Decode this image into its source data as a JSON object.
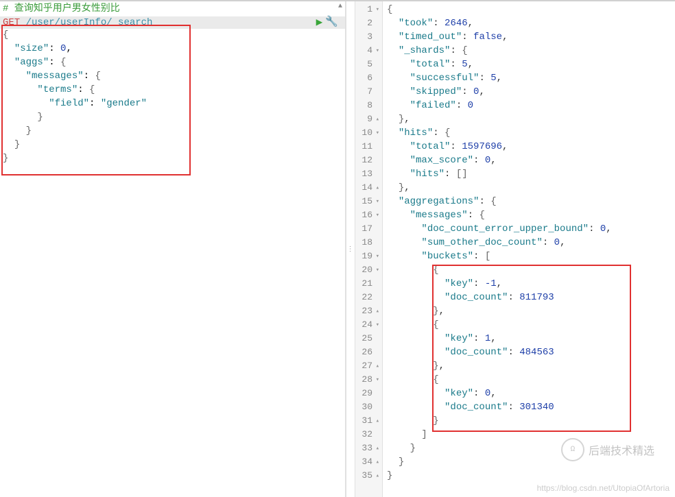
{
  "left": {
    "comment": "# 查询知乎用户男女性别比",
    "method": "GET",
    "path": " /user/userInfo/_search",
    "lines": [
      "{",
      "  \"size\": 0,",
      "  \"aggs\": {",
      "    \"messages\": {",
      "      \"terms\": {",
      "        \"field\": \"gender\"",
      "      }",
      "    }",
      "  }",
      "}"
    ]
  },
  "right": {
    "lines": [
      {
        "n": "1",
        "fold": "▾",
        "t": "{"
      },
      {
        "n": "2",
        "t": "  \"took\": 2646,"
      },
      {
        "n": "3",
        "t": "  \"timed_out\": false,"
      },
      {
        "n": "4",
        "fold": "▾",
        "t": "  \"_shards\": {"
      },
      {
        "n": "5",
        "t": "    \"total\": 5,"
      },
      {
        "n": "6",
        "t": "    \"successful\": 5,"
      },
      {
        "n": "7",
        "t": "    \"skipped\": 0,"
      },
      {
        "n": "8",
        "t": "    \"failed\": 0"
      },
      {
        "n": "9",
        "fold": "▴",
        "t": "  },"
      },
      {
        "n": "10",
        "fold": "▾",
        "t": "  \"hits\": {"
      },
      {
        "n": "11",
        "t": "    \"total\": 1597696,"
      },
      {
        "n": "12",
        "t": "    \"max_score\": 0,"
      },
      {
        "n": "13",
        "t": "    \"hits\": []"
      },
      {
        "n": "14",
        "fold": "▴",
        "t": "  },"
      },
      {
        "n": "15",
        "fold": "▾",
        "t": "  \"aggregations\": {"
      },
      {
        "n": "16",
        "fold": "▾",
        "t": "    \"messages\": {"
      },
      {
        "n": "17",
        "t": "      \"doc_count_error_upper_bound\": 0,"
      },
      {
        "n": "18",
        "t": "      \"sum_other_doc_count\": 0,"
      },
      {
        "n": "19",
        "fold": "▾",
        "t": "      \"buckets\": ["
      },
      {
        "n": "20",
        "fold": "▾",
        "t": "        {"
      },
      {
        "n": "21",
        "t": "          \"key\": -1,"
      },
      {
        "n": "22",
        "t": "          \"doc_count\": 811793"
      },
      {
        "n": "23",
        "fold": "▴",
        "t": "        },"
      },
      {
        "n": "24",
        "fold": "▾",
        "t": "        {"
      },
      {
        "n": "25",
        "t": "          \"key\": 1,"
      },
      {
        "n": "26",
        "t": "          \"doc_count\": 484563"
      },
      {
        "n": "27",
        "fold": "▴",
        "t": "        },"
      },
      {
        "n": "28",
        "fold": "▾",
        "t": "        {"
      },
      {
        "n": "29",
        "t": "          \"key\": 0,"
      },
      {
        "n": "30",
        "t": "          \"doc_count\": 301340"
      },
      {
        "n": "31",
        "fold": "▴",
        "t": "        }"
      },
      {
        "n": "32",
        "t": "      ]"
      },
      {
        "n": "33",
        "fold": "▴",
        "t": "    }"
      },
      {
        "n": "34",
        "fold": "▴",
        "t": "  }"
      },
      {
        "n": "35",
        "fold": "▴",
        "t": "}"
      }
    ]
  },
  "watermark": {
    "logo": "Ω",
    "text": "后端技术精选",
    "url": "https://blog.csdn.net/UtopiaOfArtoria"
  }
}
